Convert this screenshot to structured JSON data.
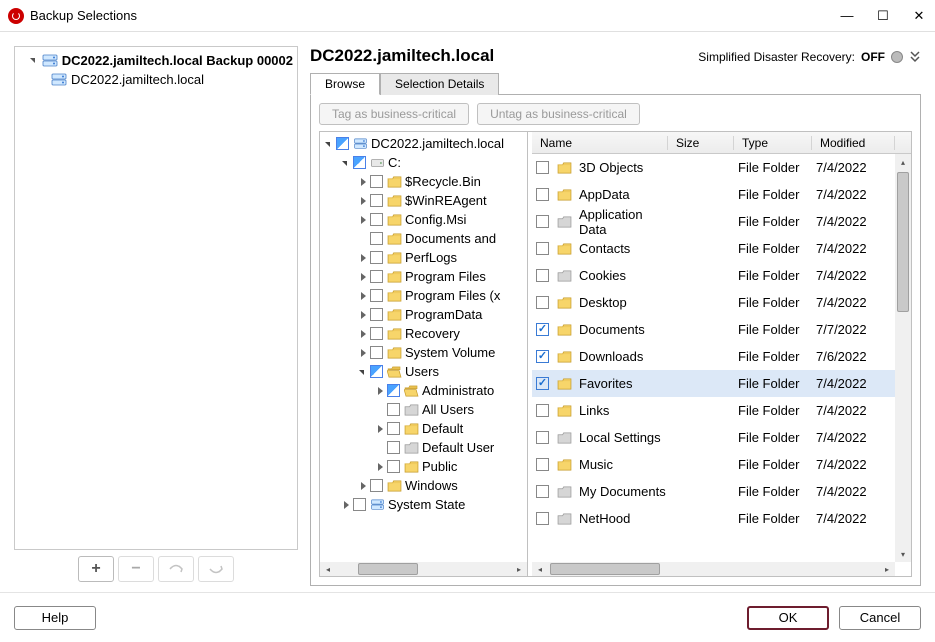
{
  "window": {
    "title": "Backup Selections",
    "minimize": "—",
    "maximize": "▢",
    "close": "✕"
  },
  "leftTree": {
    "root": "DC2022.jamiltech.local Backup 00002",
    "child": "DC2022.jamiltech.local"
  },
  "leftToolbar": {
    "add": "+",
    "remove": "−",
    "up": "↺",
    "down": "↻"
  },
  "header": {
    "title": "DC2022.jamiltech.local",
    "sdr_label": "Simplified Disaster Recovery:",
    "sdr_state": "OFF",
    "chevrons": "⌄"
  },
  "tabs": {
    "browse": "Browse",
    "selection": "Selection Details"
  },
  "tagButtons": {
    "tag": "Tag as business-critical",
    "untag": "Untag as business-critical"
  },
  "dirTree": {
    "root": "DC2022.jamiltech.local",
    "drive": "C:",
    "folders": [
      {
        "name": "$Recycle.Bin",
        "exp": true
      },
      {
        "name": "$WinREAgent",
        "exp": true
      },
      {
        "name": "Config.Msi",
        "exp": true
      },
      {
        "name": "Documents and",
        "exp": false
      },
      {
        "name": "PerfLogs",
        "exp": true
      },
      {
        "name": "Program Files",
        "exp": true
      },
      {
        "name": "Program Files (x",
        "exp": true
      },
      {
        "name": "ProgramData",
        "exp": true
      },
      {
        "name": "Recovery",
        "exp": true
      },
      {
        "name": "System Volume",
        "exp": true
      }
    ],
    "users": "Users",
    "usersChildren": [
      {
        "name": "Administrato",
        "exp": true,
        "open": true,
        "partial": true
      },
      {
        "name": "All Users",
        "exp": false
      },
      {
        "name": "Default",
        "exp": true
      },
      {
        "name": "Default User",
        "exp": false
      },
      {
        "name": "Public",
        "exp": true
      }
    ],
    "windows": "Windows",
    "systemState": "System State"
  },
  "fileTable": {
    "headers": {
      "name": "Name",
      "size": "Size",
      "type": "Type",
      "modified": "Modified"
    },
    "rows": [
      {
        "name": "3D Objects",
        "type": "File Folder",
        "modified": "7/4/2022",
        "checked": false,
        "selected": false
      },
      {
        "name": "AppData",
        "type": "File Folder",
        "modified": "7/4/2022",
        "checked": false,
        "selected": false
      },
      {
        "name": "Application Data",
        "type": "File Folder",
        "modified": "7/4/2022",
        "checked": false,
        "selected": false
      },
      {
        "name": "Contacts",
        "type": "File Folder",
        "modified": "7/4/2022",
        "checked": false,
        "selected": false
      },
      {
        "name": "Cookies",
        "type": "File Folder",
        "modified": "7/4/2022",
        "checked": false,
        "selected": false
      },
      {
        "name": "Desktop",
        "type": "File Folder",
        "modified": "7/4/2022",
        "checked": false,
        "selected": false
      },
      {
        "name": "Documents",
        "type": "File Folder",
        "modified": "7/7/2022",
        "checked": true,
        "selected": false
      },
      {
        "name": "Downloads",
        "type": "File Folder",
        "modified": "7/6/2022",
        "checked": true,
        "selected": false
      },
      {
        "name": "Favorites",
        "type": "File Folder",
        "modified": "7/4/2022",
        "checked": true,
        "selected": true
      },
      {
        "name": "Links",
        "type": "File Folder",
        "modified": "7/4/2022",
        "checked": false,
        "selected": false
      },
      {
        "name": "Local Settings",
        "type": "File Folder",
        "modified": "7/4/2022",
        "checked": false,
        "selected": false
      },
      {
        "name": "Music",
        "type": "File Folder",
        "modified": "7/4/2022",
        "checked": false,
        "selected": false
      },
      {
        "name": "My Documents",
        "type": "File Folder",
        "modified": "7/4/2022",
        "checked": false,
        "selected": false
      },
      {
        "name": "NetHood",
        "type": "File Folder",
        "modified": "7/4/2022",
        "checked": false,
        "selected": false
      }
    ]
  },
  "footer": {
    "help": "Help",
    "ok": "OK",
    "cancel": "Cancel"
  }
}
